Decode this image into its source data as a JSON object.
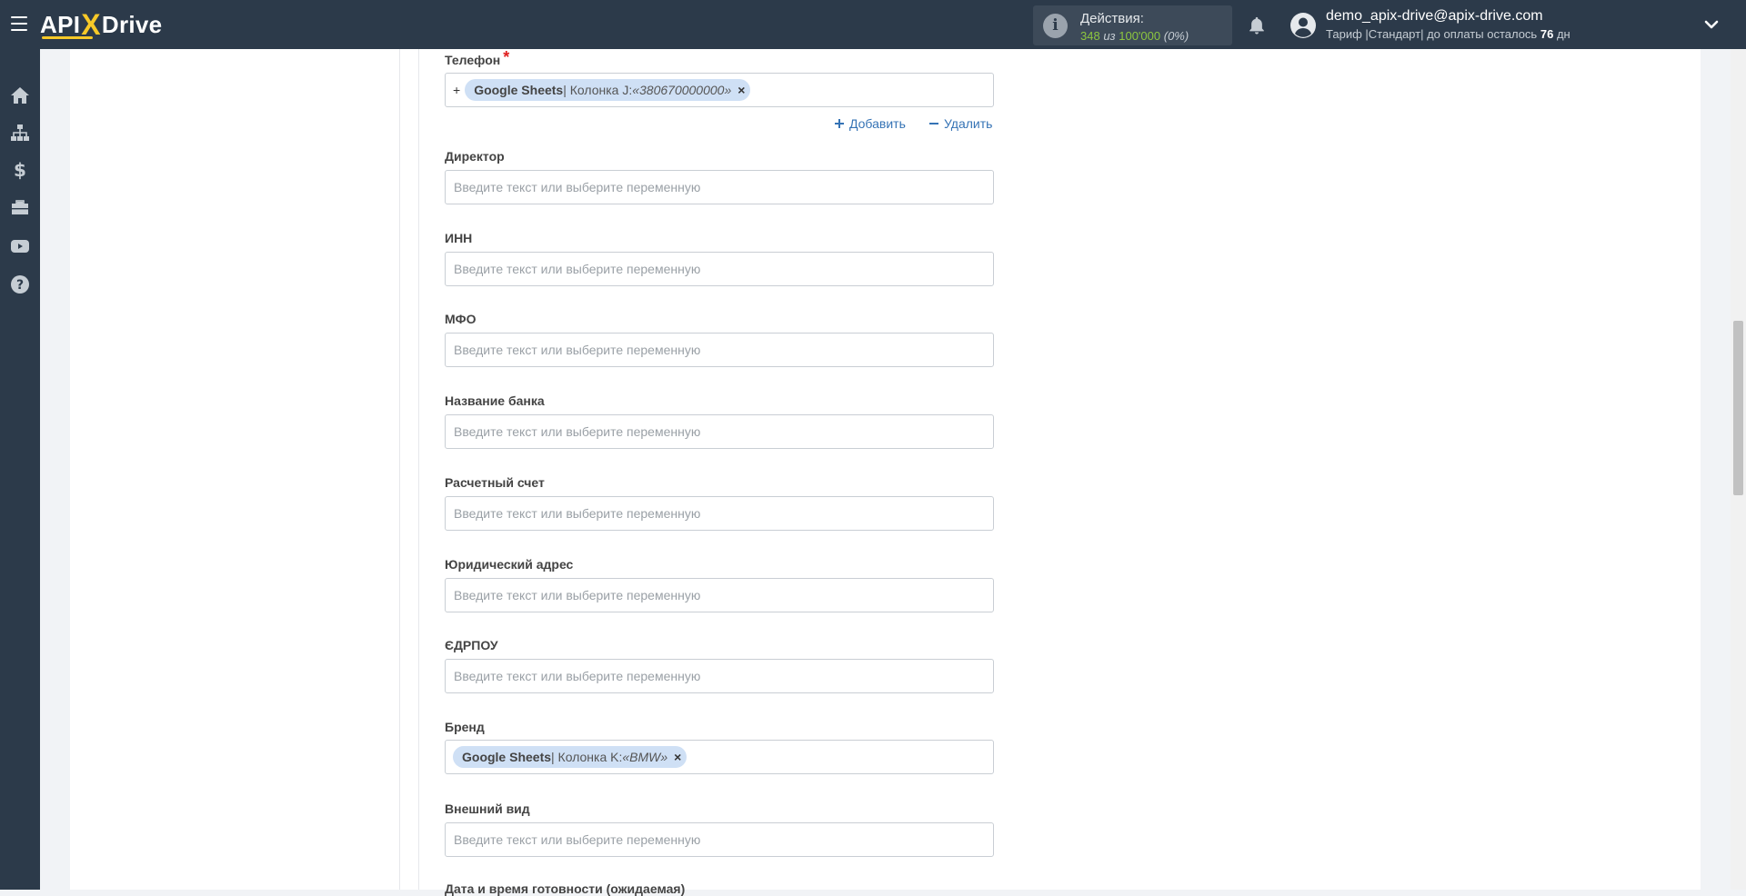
{
  "header": {
    "logo": {
      "api": "API",
      "x": "X",
      "drive": "Drive"
    },
    "actions": {
      "title": "Действия:",
      "used": "348",
      "of_word": "из",
      "total": "100'000",
      "percent": "(0%)"
    },
    "user": {
      "email": "demo_apix-drive@apix-drive.com",
      "plan_prefix": "Тариф |Стандарт| до оплаты осталось",
      "days": "76",
      "days_unit": "дн"
    }
  },
  "sidebar": {
    "items": [
      {
        "icon": "home-icon"
      },
      {
        "icon": "sitemap-icon"
      },
      {
        "icon": "dollar-icon"
      },
      {
        "icon": "briefcase-icon"
      },
      {
        "icon": "youtube-icon"
      },
      {
        "icon": "help-icon"
      }
    ]
  },
  "form": {
    "placeholder": "Введите текст или выберите переменную",
    "phone": {
      "label": "Телефон",
      "required_mark": "*",
      "prefix": "+",
      "tag": {
        "source": "Google Sheets",
        "column": " | Колонка J: ",
        "value": "«380670000000»",
        "remove": "×"
      },
      "add_label": "Добавить",
      "remove_label": "Удалить"
    },
    "fields": [
      {
        "label": "Директор"
      },
      {
        "label": "ИНН"
      },
      {
        "label": "МФО"
      },
      {
        "label": "Название банка"
      },
      {
        "label": "Расчетный счет"
      },
      {
        "label": "Юридический адрес"
      },
      {
        "label": "ЄДРПОУ"
      }
    ],
    "brand": {
      "label": "Бренд",
      "tag": {
        "source": "Google Sheets",
        "column": " | Колонка K: ",
        "value": "«BMW»",
        "remove": "×"
      }
    },
    "appearance": {
      "label": "Внешний вид"
    },
    "next_label": "Дата и время готовности (ожидаемая)"
  }
}
